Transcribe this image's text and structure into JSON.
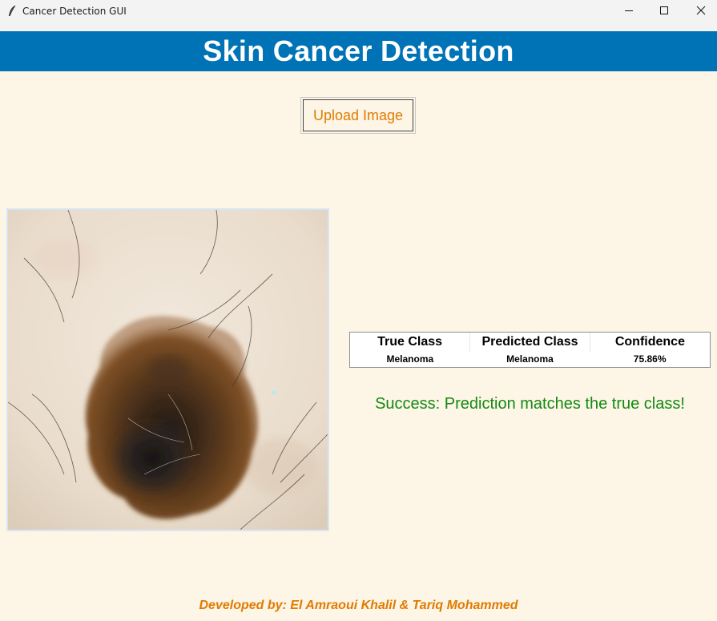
{
  "window": {
    "title": "Cancer Detection GUI",
    "icon": "feather-icon",
    "controls": [
      "minimize-icon",
      "maximize-icon",
      "close-icon"
    ]
  },
  "header": {
    "title": "Skin Cancer Detection",
    "background": "#0073b7"
  },
  "upload_button": {
    "label": "Upload Image",
    "color": "#e07b00"
  },
  "image": {
    "description_name": "skin-lesion-image"
  },
  "results": {
    "columns": [
      "True Class",
      "Predicted Class",
      "Confidence"
    ],
    "row": [
      "Melanoma",
      "Melanoma",
      "75.86%"
    ]
  },
  "status": {
    "message": "Success: Prediction matches the true class!",
    "color": "#138a13"
  },
  "footer": {
    "text": "Developed by: El Amraoui Khalil & Tariq Mohammed",
    "color": "#e07b00"
  },
  "colors": {
    "background": "#fdf5e6"
  }
}
